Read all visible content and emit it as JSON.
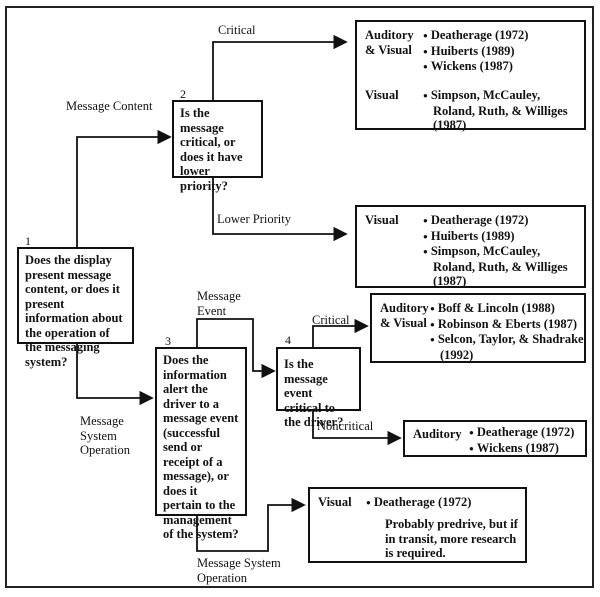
{
  "nodes": {
    "n1": {
      "number": "1",
      "text": "Does the display present message content, or does it present information about the operation of the messaging system?"
    },
    "n2": {
      "number": "2",
      "text": "Is the message critical, or does it have lower priority?"
    },
    "n3": {
      "number": "3",
      "text": "Does the information alert the driver to a message event (successful send or receipt of a message), or does it pertain to the management of the system?"
    },
    "n4": {
      "number": "4",
      "text": "Is the message event critical to the driver?"
    }
  },
  "edges": {
    "message_content": "Message Content",
    "message_system_operation_1": "Message System Operation",
    "critical_2": "Critical",
    "lower_priority": "Lower Priority",
    "message_event": "Message Event",
    "critical_4": "Critical",
    "noncritical": "Noncritical",
    "message_system_operation_3": "Message System Operation"
  },
  "results": {
    "a": {
      "groups": [
        {
          "modality": "Auditory & Visual",
          "refs": [
            "Deatherage (1972)",
            "Huiberts (1989)",
            "Wickens (1987)"
          ]
        },
        {
          "modality": "Visual",
          "refs": [
            "Simpson, McCauley, Roland, Ruth, & Williges (1987)"
          ]
        }
      ]
    },
    "b": {
      "groups": [
        {
          "modality": "Visual",
          "refs": [
            "Deatherage (1972)",
            "Huiberts (1989)",
            "Simpson, McCauley, Roland, Ruth, & Williges (1987)"
          ]
        }
      ]
    },
    "c": {
      "groups": [
        {
          "modality": "Auditory & Visual",
          "refs": [
            "Boff & Lincoln (1988)",
            "Robinson & Eberts (1987)",
            "Selcon, Taylor, & Shadrake (1992)"
          ]
        }
      ]
    },
    "d": {
      "groups": [
        {
          "modality": "Auditory",
          "refs": [
            "Deatherage (1972)",
            "Wickens (1987)"
          ]
        }
      ]
    },
    "e": {
      "groups": [
        {
          "modality": "Visual",
          "refs": [
            "Deatherage (1972)"
          ]
        }
      ],
      "note": "Probably predrive, but if in transit, more research is required."
    }
  }
}
